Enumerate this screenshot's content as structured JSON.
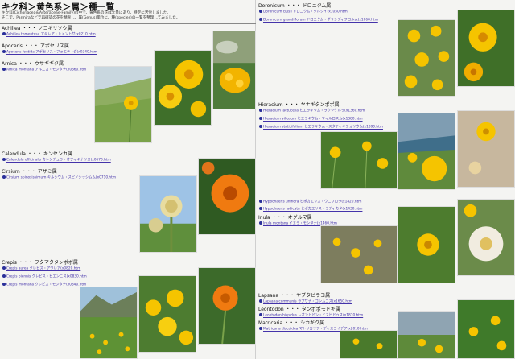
{
  "page_title": "キク科＞黄色系＞属＞種一覧",
  "intro": {
    "line1": "キク科(Cichoriaceae/Asteraceae-Family)の中で、黄色系の花は大量にあり、特定に苦労しました。",
    "line2": "そこで、Parmiraなどで再確認の花を精査し、属(Genus)単位に、種(species)の一覧を整理してみました。"
  },
  "left_genera": [
    {
      "latin": "Achillea",
      "dots": "・・・",
      "jp": "ノコギリソウ属",
      "species": [
        "Achillea tomentosa アキレア・トメントサ(x0210.htm"
      ]
    },
    {
      "latin": "Apoceris",
      "dots": "・・・",
      "jp": "アポセリス属",
      "species": [
        "Apoceris foetida アポセリス・フォエティダ(x0340.htm"
      ]
    },
    {
      "latin": "Arnica",
      "dots": "・・・",
      "jp": "ウサギギク属",
      "species": [
        "Arnica montana アルニカ・モンタナ(x0360.htm"
      ]
    },
    {
      "latin": "Calendula",
      "dots": "・・・",
      "jp": "キンセンカ属",
      "species": [
        "Calendula officinalis カレンデュラ・オフィキナリス(x0670.htm"
      ]
    },
    {
      "latin": "Cirsium",
      "dots": "・・・",
      "jp": "アザミ属",
      "species": [
        "Cirsium spinosissimum キルシウム・スピノシッシムム(x0710.htm"
      ]
    },
    {
      "latin": "Crepis",
      "dots": "・・・",
      "jp": "フタマタタンポポ属",
      "species": [
        "Crepis aurea クレピス・アウレア(x0820.htm",
        "Crepis biennis クレピス・ビエンニス(x0830.htm",
        "Crepis montana クレピス・モンタナ(x0840.htm"
      ]
    }
  ],
  "right_genera": [
    {
      "latin": "Doronicum",
      "dots": "・・・",
      "jp": "ドロニクム属",
      "species": [
        "Doronicum clusii ドロニクム・クルシイ(x1050.htm",
        "Doronicum grandiflorum ドロニクム・グランディフロルム(x1060.htm"
      ]
    },
    {
      "latin": "Hieracium",
      "dots": "・・・",
      "jp": "ヤナギタンポポ属",
      "species": [
        "Hieracium lactucella ヒエラキウム・ラクツケルラ(x1360.htm",
        "Hieracium villosum ヒエラキウム・ウィルロスム(x1380.htm",
        "Hieracium staticifolium ヒエラキウム・スタティキフォリウム(x1390.htm",
        "Hypochaeris uniflora ヒポカエリス・ウニフロラ(x1420.htm",
        "Hypochaeris radicata ヒポカエリス・ラディカタ(x1430.htm"
      ]
    },
    {
      "latin": "Inula",
      "dots": "・・・",
      "jp": "オグルマ属",
      "species": [
        "Inula montana イヌラ・モンタナ(x1460.htm"
      ]
    },
    {
      "latin": "Lapsana",
      "dots": "・・・",
      "jp": "ヤブタビラコ属",
      "species": [
        "Lapsana communis ラプサナ・コンムニス(x1650.htm"
      ]
    },
    {
      "latin": "Leontodon",
      "dots": "・・・",
      "jp": "タンポポモドキ属",
      "species": [
        "Leontodon hispidus レオントドン・ヒスピドゥス(x1810.htm"
      ]
    },
    {
      "latin": "Matricaria",
      "dots": "・・・",
      "jp": "シカギク属",
      "species": [
        "Matricaria discoidea マトリカリア・ディスコイデア(x2010.htm"
      ]
    }
  ],
  "colors": {
    "link": "#4433aa",
    "bullet": "#2a2f9a",
    "flower_yellow": "#f5c400",
    "flower_orange": "#f07a10",
    "leaf_green": "#4d8a2e"
  }
}
